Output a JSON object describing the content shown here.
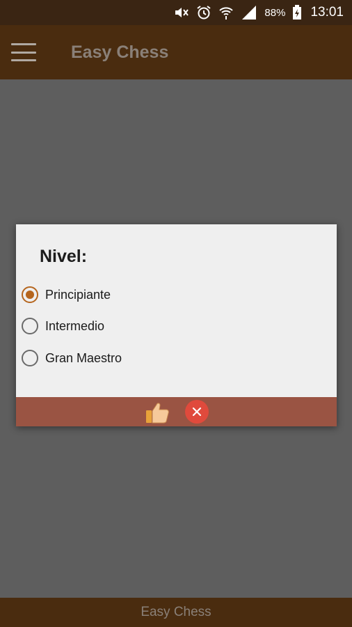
{
  "status_bar": {
    "battery": "88%",
    "time": "13:01",
    "icons": [
      "mute-icon",
      "alarm-icon",
      "wifi-icon",
      "signal-icon",
      "battery-icon"
    ]
  },
  "app_bar": {
    "title": "Easy Chess",
    "menu_icon": "hamburger-menu-icon"
  },
  "dialog": {
    "title": "Nivel:",
    "options": [
      {
        "label": "Principiante",
        "selected": true
      },
      {
        "label": "Intermedio",
        "selected": false
      },
      {
        "label": "Gran Maestro",
        "selected": false
      }
    ],
    "confirm_icon": "thumbs-up-icon",
    "cancel_icon": "close-icon"
  },
  "footer": {
    "text": "Easy Chess"
  },
  "colors": {
    "status_bar": "#3a2513",
    "app_bar": "#4a2c0f",
    "dialog_actions": "#9a5443",
    "radio_accent": "#b5651d",
    "cancel": "#e04a3c"
  }
}
